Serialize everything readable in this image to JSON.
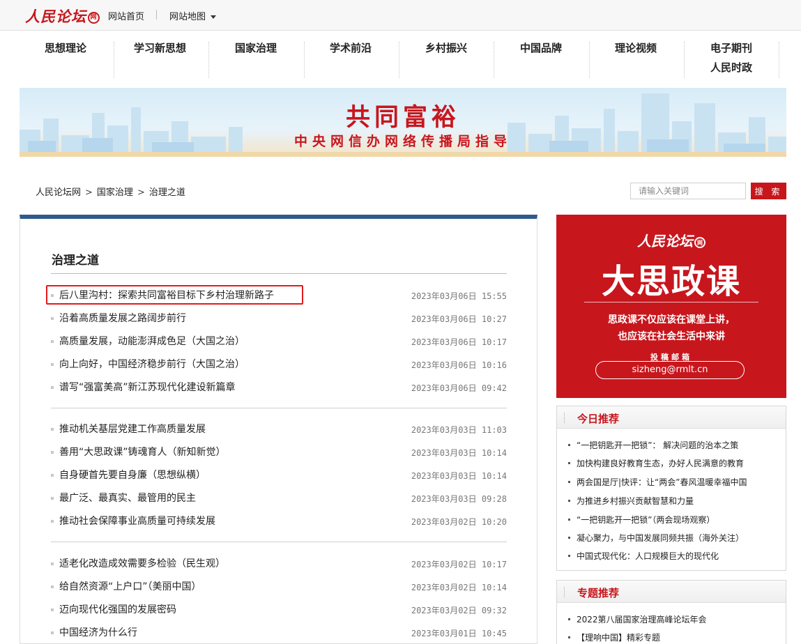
{
  "header": {
    "logo_text": "人民论坛",
    "logo_badge": "网",
    "home_link": "网站首页",
    "sitemap_link": "网站地图"
  },
  "nav": [
    {
      "label": "思想理论"
    },
    {
      "label": "学习新思想"
    },
    {
      "label": "国家治理"
    },
    {
      "label": "学术前沿"
    },
    {
      "label": "乡村振兴"
    },
    {
      "label": "中国品牌"
    },
    {
      "label": "理论视频"
    },
    {
      "label": "电子期刊"
    },
    {
      "label": "人民时政"
    }
  ],
  "banner": {
    "title": "共同富裕",
    "subtitle": "中央网信办网络传播局指导"
  },
  "breadcrumb": {
    "items": [
      "人民论坛网",
      "国家治理",
      "治理之道"
    ],
    "separator": ">"
  },
  "search": {
    "placeholder": "请输入关键词",
    "button_label": "搜 索"
  },
  "main": {
    "section_title": "治理之道",
    "articles": [
      {
        "title": "后八里沟村：探索共同富裕目标下乡村治理新路子",
        "date": "2023年03月06日 15:55"
      },
      {
        "title": "沿着高质量发展之路阔步前行",
        "date": "2023年03月06日 10:27"
      },
      {
        "title": "高质量发展，动能澎湃成色足（大国之治）",
        "date": "2023年03月06日 10:17"
      },
      {
        "title": "向上向好，中国经济稳步前行（大国之治）",
        "date": "2023年03月06日 10:16"
      },
      {
        "title": "谱写“强富美高”新江苏现代化建设新篇章",
        "date": "2023年03月06日 09:42"
      },
      {
        "title": "推动机关基层党建工作高质量发展",
        "date": "2023年03月03日 11:03"
      },
      {
        "title": "善用“大思政课”铸魂育人（新知新觉）",
        "date": "2023年03月03日 10:14"
      },
      {
        "title": "自身硬首先要自身廉（思想纵横）",
        "date": "2023年03月03日 10:14"
      },
      {
        "title": "最广泛、最真实、最管用的民主",
        "date": "2023年03月03日 09:28"
      },
      {
        "title": "推动社会保障事业高质量可持续发展",
        "date": "2023年03月02日 10:20"
      },
      {
        "title": "适老化改造成效需要多检验（民生观）",
        "date": "2023年03月02日 10:17"
      },
      {
        "title": "给自然资源“上户口”（美丽中国）",
        "date": "2023年03月02日 10:14"
      },
      {
        "title": "迈向现代化强国的发展密码",
        "date": "2023年03月02日 09:32"
      },
      {
        "title": "中国经济为什么行",
        "date": "2023年03月01日 10:45"
      }
    ]
  },
  "promo": {
    "logo_text": "人民论坛",
    "logo_badge": "网",
    "title": "大思政课",
    "line1": "思政课不仅应该在课堂上讲，",
    "line2": "也应该在社会生活中来讲",
    "email_label": "投稿邮箱",
    "email": "sizheng@rmlt.cn"
  },
  "today": {
    "title": "今日推荐",
    "items": [
      "“一把钥匙开一把锁”： 解决问题的治本之策",
      "加快构建良好教育生态，办好人民满意的教育",
      "两会国是厅|快评：让“两会”春风温暖幸福中国",
      "为推进乡村振兴贡献智慧和力量",
      "“一把钥匙开一把锁”（两会现场观察）",
      "凝心聚力，与中国发展同频共振（海外关注）",
      "中国式现代化：人口规模巨大的现代化"
    ]
  },
  "topics": {
    "title": "专题推荐",
    "items": [
      "2022第八届国家治理高峰论坛年会",
      "【理响中国】精彩专题"
    ]
  },
  "colors": {
    "brand_red": "#c8161d",
    "panel_top_blue": "#2f5a8c",
    "highlight_red": "#e01b1b"
  }
}
